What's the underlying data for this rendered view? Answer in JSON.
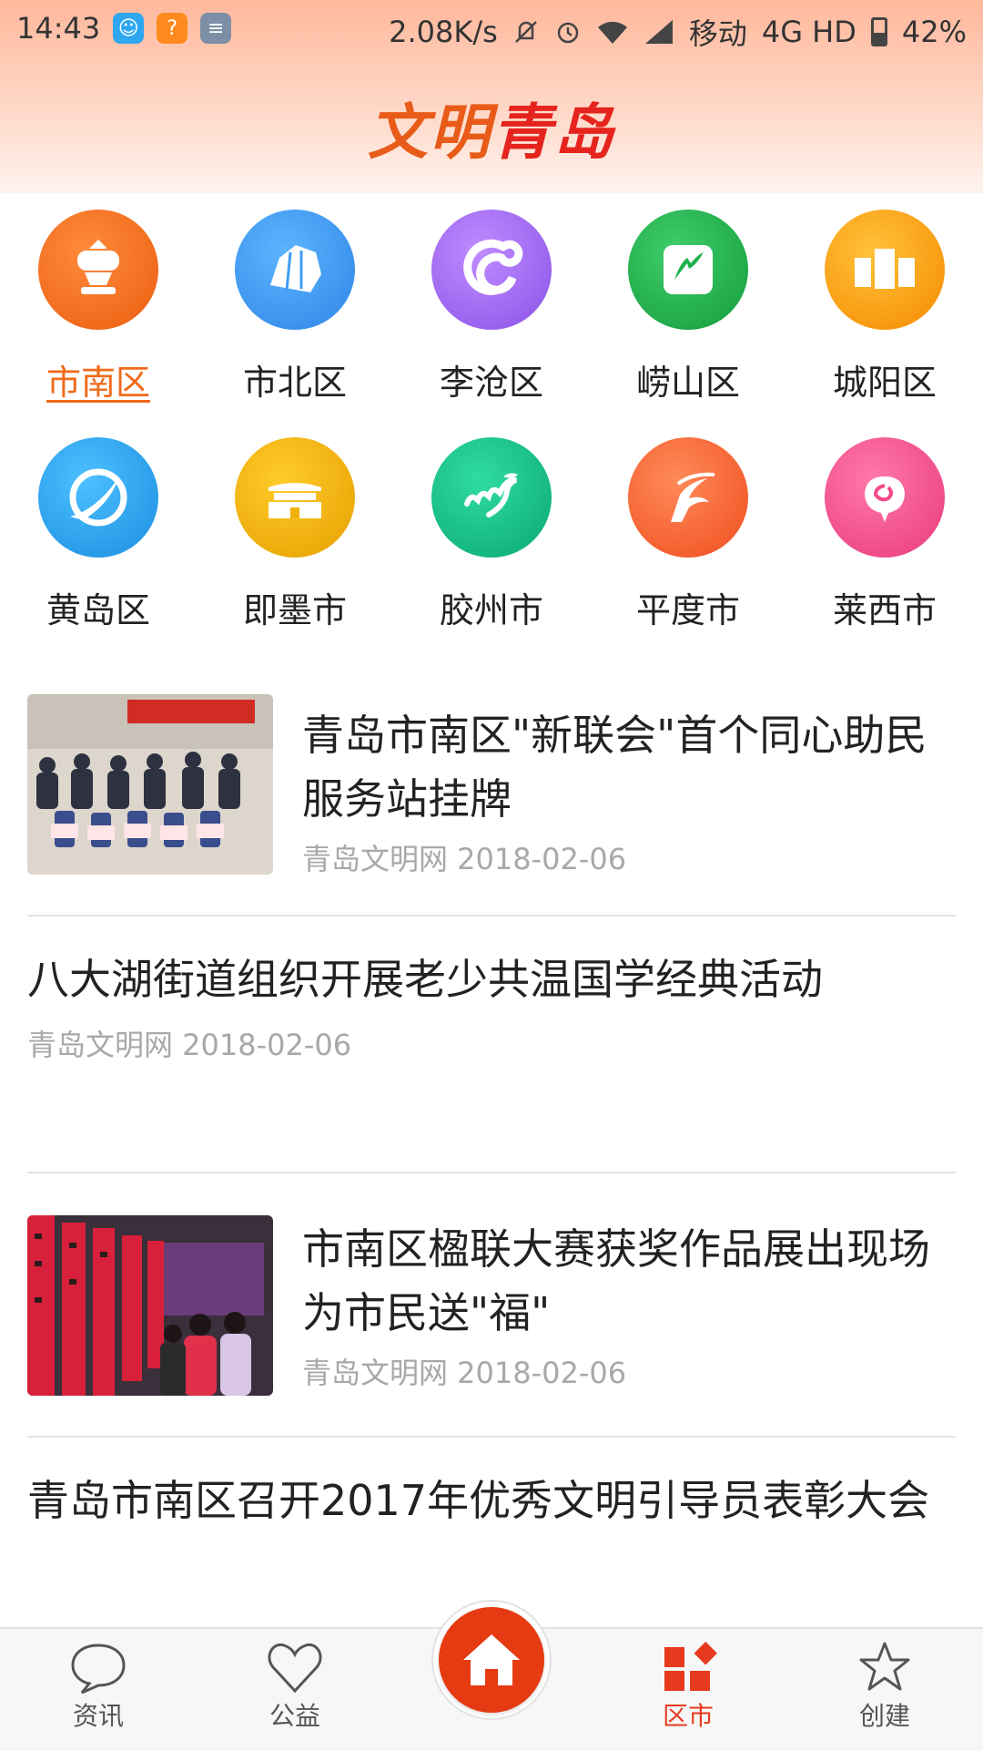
{
  "status_bar": {
    "time": "14:43",
    "net_speed": "2.08K/s",
    "carrier": "移动",
    "network": "4G HD",
    "battery": "42%"
  },
  "app": {
    "logo_part1": "文明",
    "logo_part2": "青岛"
  },
  "districts": [
    {
      "label": "市南区",
      "icon": "shinan-emblem-icon",
      "color": "#f06a1a",
      "active": true
    },
    {
      "label": "市北区",
      "icon": "shibei-emblem-icon",
      "color": "#3f9cf0"
    },
    {
      "label": "李沧区",
      "icon": "licang-emblem-icon",
      "color": "#a66ef2"
    },
    {
      "label": "崂山区",
      "icon": "laoshan-emblem-icon",
      "color": "#1fb24b"
    },
    {
      "label": "城阳区",
      "icon": "chengyang-emblem-icon",
      "color": "#ffa20a"
    },
    {
      "label": "黄岛区",
      "icon": "huangdao-emblem-icon",
      "color": "#2aa4ea"
    },
    {
      "label": "即墨市",
      "icon": "jimo-emblem-icon",
      "color": "#f2b10a"
    },
    {
      "label": "胶州市",
      "icon": "jiaozhou-emblem-icon",
      "color": "#13c48a"
    },
    {
      "label": "平度市",
      "icon": "pingdu-emblem-icon",
      "color": "#ff6a3a"
    },
    {
      "label": "莱西市",
      "icon": "laixi-emblem-icon",
      "color": "#f54a8a"
    }
  ],
  "news": [
    {
      "title": "青岛市南区\"新联会\"首个同心助民服务站挂牌",
      "source": "青岛文明网 2018-02-06",
      "has_image": true
    },
    {
      "title": "八大湖街道组织开展老少共温国学经典活动",
      "source": "青岛文明网 2018-02-06",
      "has_image": false
    },
    {
      "title": "市南区楹联大赛获奖作品展出现场为市民送\"福\"",
      "source": "青岛文明网 2018-02-06",
      "has_image": true
    },
    {
      "title": "青岛市南区召开2017年优秀文明引导员表彰大会",
      "source": "",
      "has_image": false
    }
  ],
  "bottom_nav": {
    "items": [
      {
        "label": "资讯",
        "icon": "chat-bubble-icon"
      },
      {
        "label": "公益",
        "icon": "heart-icon"
      },
      {
        "label": "区市",
        "icon": "grid-diamond-icon",
        "active": true
      },
      {
        "label": "创建",
        "icon": "star-icon"
      }
    ],
    "home_icon": "home-icon"
  },
  "colors": {
    "accent": "#e53a12",
    "active_district": "#f06a1a",
    "meta_text": "#a8a8a8"
  }
}
